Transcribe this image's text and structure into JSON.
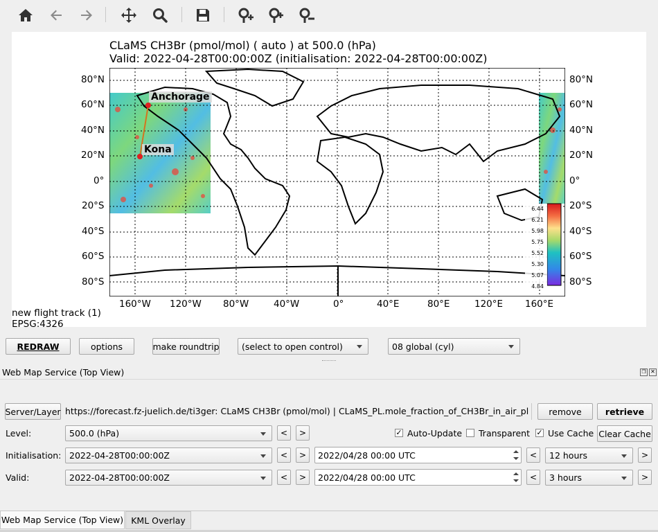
{
  "toolbar": {
    "icons": [
      "home-icon",
      "back-arrow-icon",
      "forward-arrow-icon",
      "pan-move-icon",
      "zoom-magnifier-icon",
      "save-floppy-icon",
      "insert-waypoint-icon",
      "move-waypoint-icon",
      "delete-waypoint-icon"
    ]
  },
  "plot": {
    "title_line1": "CLaMS CH3Br (pmol/mol) ( auto ) at 500.0 (hPa)",
    "title_line2": "Valid: 2022-04-28T00:00:00Z (initialisation: 2022-04-28T00:00:00Z)",
    "lat_ticks": [
      "80°N",
      "60°N",
      "40°N",
      "20°N",
      "0°",
      "20°S",
      "40°S",
      "60°S",
      "80°S"
    ],
    "lon_ticks": [
      "160°W",
      "120°W",
      "80°W",
      "40°W",
      "0°",
      "40°E",
      "80°E",
      "120°E",
      "160°E"
    ],
    "waypoints": [
      {
        "label": "Anchorage",
        "lat": 61.2,
        "lon": -149.9
      },
      {
        "label": "Kona",
        "lat": 19.6,
        "lon": -156.0
      }
    ],
    "colorbar_labels": [
      "6.44",
      "6.21",
      "5.98",
      "5.75",
      "5.52",
      "5.30",
      "5.07",
      "4.84"
    ],
    "flight_track_label": "new flight track (1)",
    "projection_label": "EPSG:4326"
  },
  "controls": {
    "redraw": "REDRAW",
    "options": "options",
    "make_roundtrip": "make roundtrip",
    "control_select": "(select to open control)",
    "map_section": "08 global (cyl)"
  },
  "wms": {
    "dock_title": "Web Map Service (Top View)",
    "server_layer_btn": "Server/Layer",
    "layer_desc": "https://forecast.fz-juelich.de/ti3ger: CLaMS CH3Br (pmol/mol) | CLaMS_PL.mole_fraction_of_CH3Br_in_air_pl",
    "remove": "remove",
    "retrieve": "retrieve",
    "level_label": "Level:",
    "level_value": "500.0 (hPa)",
    "prev": "<",
    "next": ">",
    "auto_update": "Auto-Update",
    "transparent": "Transparent",
    "use_cache": "Use Cache",
    "clear_cache": "Clear Cache",
    "init_label": "Initialisation:",
    "init_value": "2022-04-28T00:00:00Z",
    "init_datetime": "2022/04/28 00:00 UTC",
    "init_step": "12 hours",
    "valid_label": "Valid:",
    "valid_value": "2022-04-28T00:00:00Z",
    "valid_datetime": "2022/04/28 00:00 UTC",
    "valid_step": "3 hours",
    "check": "✓"
  },
  "tabs": [
    "Web Map Service (Top View)",
    "KML Overlay"
  ]
}
